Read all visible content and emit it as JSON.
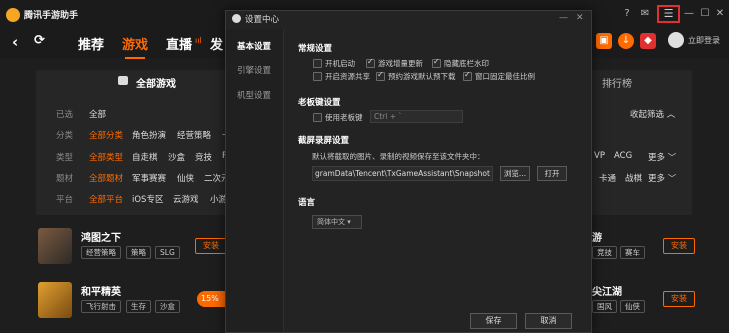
{
  "app": {
    "title": "腾讯手游助手"
  },
  "nav": {
    "tabs": [
      "推荐",
      "游戏",
      "直播",
      "发"
    ],
    "live_badge": "ııl",
    "login": "立即登录"
  },
  "panel": {
    "header": "全部游戏",
    "right_header": "排行榜",
    "collapse": "收起筛选",
    "filters": [
      {
        "label": "已选",
        "items": [
          "全部"
        ]
      },
      {
        "label": "分类",
        "items": [
          "全部分类",
          "角色扮演",
          "经营策略",
          "卡"
        ]
      },
      {
        "label": "类型",
        "items": [
          "全部类型",
          "自走棋",
          "沙盒",
          "竞技",
          "P"
        ]
      },
      {
        "label": "题材",
        "items": [
          "全部题材",
          "军事赛赛",
          "仙侠",
          "二次元",
          "三"
        ]
      },
      {
        "label": "平台",
        "items": [
          "全部平台",
          "iOS专区",
          "云游戏",
          "小游"
        ]
      }
    ],
    "right_filters": [
      {
        "items": [
          "VP",
          "ACG"
        ],
        "more": "更多"
      },
      {
        "items": [
          "卡通",
          "战棋"
        ],
        "more": "更多"
      }
    ]
  },
  "games": [
    {
      "name": "鸿图之下",
      "tags": [
        "经营策略",
        "策略",
        "SLG"
      ],
      "install": "安装",
      "icon_color": "#7a5a40"
    },
    {
      "name": "和平精英",
      "tags": [
        "飞行射击",
        "生存",
        "沙盒"
      ],
      "install": "安装",
      "progress": "15%",
      "icon_color": "#c98a2a"
    }
  ],
  "right_games": [
    {
      "name": "游",
      "tags": [
        "竞技",
        "赛车"
      ],
      "install": "安装"
    },
    {
      "name": "尖江湖",
      "tags": [
        "国风",
        "仙侠"
      ],
      "install": "安装"
    }
  ],
  "dialog": {
    "title": "设置中心",
    "sidebar": [
      "基本设置",
      "引擎设置",
      "机型设置"
    ],
    "general": {
      "title": "常规设置",
      "options": [
        {
          "label": "开机启动",
          "checked": false
        },
        {
          "label": "游戏增量更新",
          "checked": true
        },
        {
          "label": "隐藏底栏水印",
          "checked": true
        },
        {
          "label": "开启资源共享",
          "checked": false
        },
        {
          "label": "预约游戏默认预下载",
          "checked": true
        },
        {
          "label": "窗口固定最佳比例",
          "checked": true
        }
      ]
    },
    "boss_key": {
      "title": "老板键设置",
      "option_label": "使用老板键",
      "placeholder": "Ctrl + `"
    },
    "screenshot": {
      "title": "截屏录屏设置",
      "desc": "默认将截取的图片、录制的视频保存至该文件夹中：",
      "path": "gramData\\Tencent\\TxGameAssistant\\Snapshot",
      "browse": "浏览...",
      "open": "打开"
    },
    "language": {
      "title": "语言",
      "selected": "简体中文"
    },
    "save": "保存",
    "cancel": "取消"
  }
}
